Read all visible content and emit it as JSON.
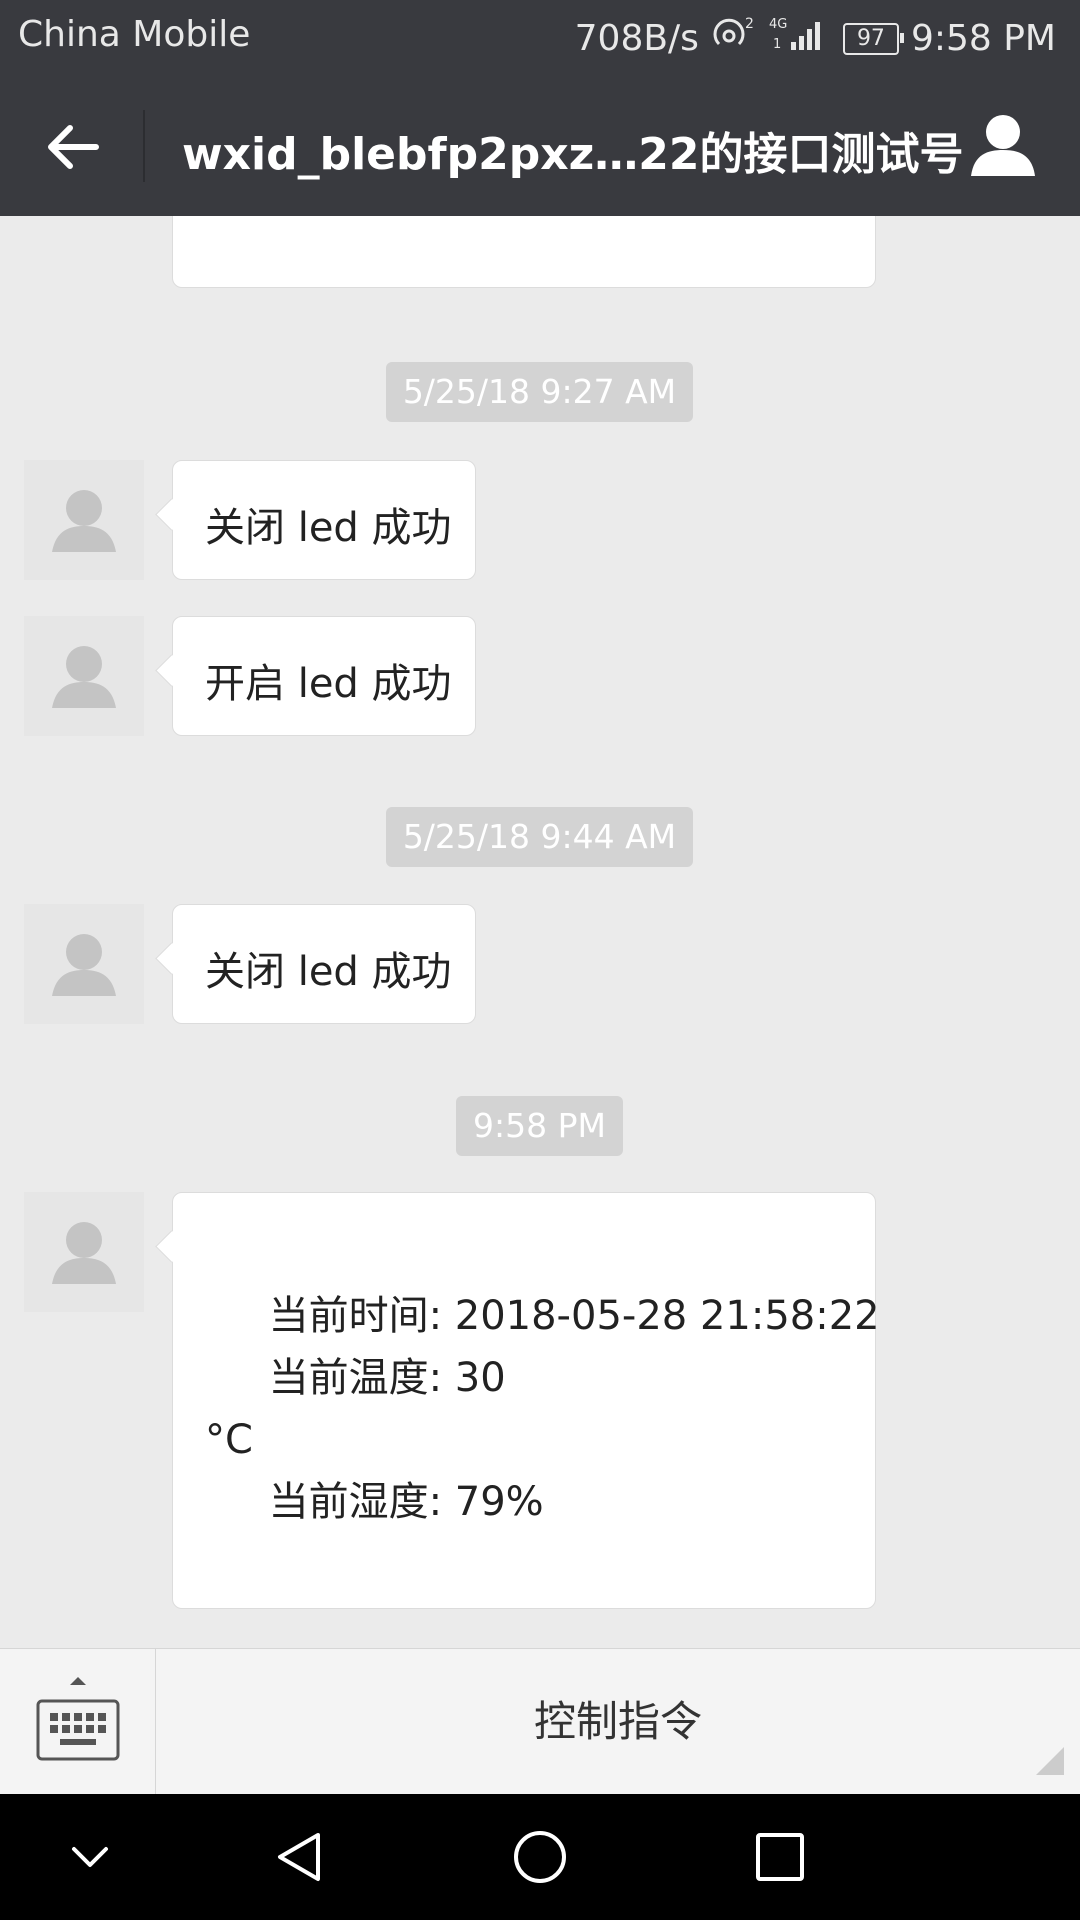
{
  "status_bar": {
    "carrier": "China Mobile",
    "network_speed": "708B/s",
    "battery": "97",
    "time": "9:58 PM"
  },
  "header": {
    "title": "wxid_blebfp2pxz…22的接口测试号",
    "back_icon": "arrow-left-icon",
    "profile_icon": "person-icon"
  },
  "messages": [
    {
      "timestamp": "5/25/18 9:27 AM"
    },
    {
      "text": "关闭 led 成功"
    },
    {
      "text": "开启 led 成功"
    },
    {
      "timestamp": "5/25/18 9:44 AM"
    },
    {
      "text": "关闭 led 成功"
    },
    {
      "timestamp": "9:58 PM"
    },
    {
      "text": "     当前时间: 2018-05-28 21:58:22\n     当前温度: 30\n°C\n     当前湿度: 79%"
    }
  ],
  "input_bar": {
    "menu_label": "控制指令",
    "keyboard_icon": "keyboard-icon"
  },
  "nav_bar": {
    "icons": [
      "chevron-down-icon",
      "back-triangle-icon",
      "home-circle-icon",
      "recents-square-icon"
    ]
  }
}
